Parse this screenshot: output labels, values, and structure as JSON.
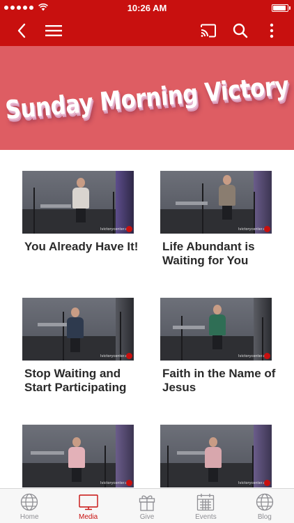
{
  "status_bar": {
    "time": "10:26 AM",
    "battery_level": 0.95
  },
  "nav": {
    "back_icon": "back-chevron-icon",
    "menu_icon": "hamburger-menu-icon",
    "cast_icon": "cast-icon",
    "search_icon": "search-icon",
    "more_icon": "more-vertical-icon"
  },
  "banner": {
    "title": "Sunday Morning Victory"
  },
  "videos": [
    {
      "title": "You Already Have It!",
      "watermark": "lvictorycenter.org"
    },
    {
      "title": "Life Abundant is Waiting for You",
      "watermark": "lvictorycenter.org"
    },
    {
      "title": "Stop Waiting and Start Participating",
      "watermark": "lvictorycenter.org"
    },
    {
      "title": "Faith in the Name of Jesus",
      "watermark": "lvictorycenter.org"
    },
    {
      "title": "",
      "watermark": "lvictorycenter.org"
    },
    {
      "title": "",
      "watermark": "lvictorycenter.org"
    }
  ],
  "tabs": [
    {
      "label": "Home",
      "icon": "globe-icon",
      "active": false
    },
    {
      "label": "Media",
      "icon": "tv-icon",
      "active": true
    },
    {
      "label": "Give",
      "icon": "gift-icon",
      "active": false
    },
    {
      "label": "Events",
      "icon": "calendar-icon",
      "active": false
    },
    {
      "label": "Blog",
      "icon": "globe-icon",
      "active": false
    }
  ],
  "colors": {
    "brand_red": "#c8100f",
    "banner_bg": "#de5d63",
    "tab_inactive": "#8e8e93"
  }
}
